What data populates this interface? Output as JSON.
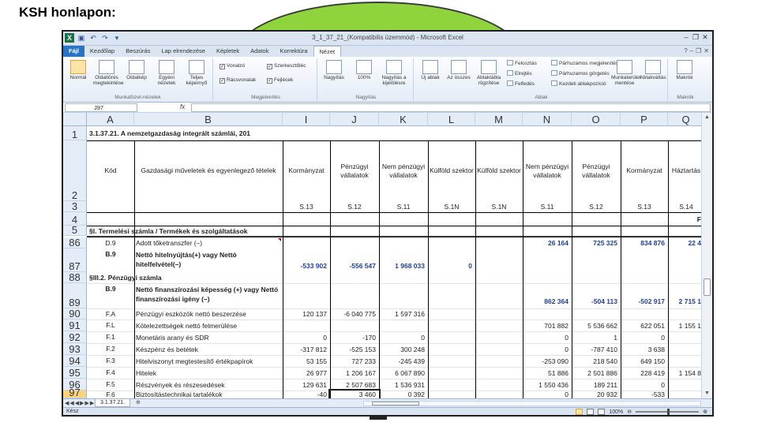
{
  "slide": {
    "title": "KSH honlapon:"
  },
  "window": {
    "title": "3_1_37_21_(Kompatibilis üzemmód) - Microsoft Excel",
    "qat_icons": [
      "excel-logo-icon",
      "save-icon",
      "undo-icon",
      "redo-icon",
      "customize-icon"
    ],
    "controls": [
      "minimize-icon",
      "restore-icon",
      "close-icon"
    ]
  },
  "tabs": [
    {
      "label": "Fájl",
      "kind": "file"
    },
    {
      "label": "Kezdőlap"
    },
    {
      "label": "Beszúrás"
    },
    {
      "label": "Lap elrendezése"
    },
    {
      "label": "Képletek"
    },
    {
      "label": "Adatok"
    },
    {
      "label": "Korrektúra"
    },
    {
      "label": "Nézet",
      "active": true
    }
  ],
  "ribbon": {
    "views": {
      "normal": "Normál",
      "page_break": "Oldaltörés megtekintése",
      "page_layout": "Oldalkép",
      "custom": "Egyéni nézetek",
      "full": "Teljes képernyő",
      "group": "Munkafüzet-nézetek"
    },
    "show": {
      "ruler": "Vonalzó",
      "formula_bar": "Szerkesztőléc",
      "gridlines": "Rácsvonalak",
      "headings": "Fejlécek",
      "group": "Megjelenítés"
    },
    "zoom": {
      "zoom": "Nagyítás",
      "hundred": "100%",
      "selection": "Nagyítás a kijelölésre",
      "group": "Nagyítás"
    },
    "window": {
      "new": "Új ablak",
      "arrange": "Az összes",
      "freeze": "Ablaktábla rögzítése",
      "split": "Felosztás",
      "hide": "Elrejtés",
      "unhide": "Felfedés",
      "side_by_side": "Párhuzamos megjelenítés",
      "sync_scroll": "Párhuzamos görgetés",
      "reset": "Kezdeti ablakpozíció",
      "save_ws": "Munkaterület mentése",
      "switch": "Ablakváltás",
      "group": "Ablak"
    },
    "macros": {
      "label": "Makrók",
      "group": "Makrók"
    }
  },
  "formula_bar": {
    "name_box": "J97",
    "fx": "fx",
    "content": ""
  },
  "columns": [
    "A",
    "B",
    "I",
    "J",
    "K",
    "L",
    "M",
    "N",
    "O",
    "P",
    "Q"
  ],
  "rows": {
    "r1": {
      "num": "1",
      "title": "3.1.37.21. A nemzetgazdaság integrált számlái, 201"
    },
    "r2": {
      "num": "2",
      "A": "Kód",
      "B": "Gazdasági műveletek és egyenlegező tételek",
      "I": "Kormányzat",
      "J": "Pénzügyi vállalatok",
      "K": "Nem pénzügyi vállalatok",
      "L": "Külföld szektor",
      "M": "Külföld szektor",
      "N": "Nem pénzügyi vállalatok",
      "O": "Pénzügyi vállalatok",
      "P": "Kormányzat",
      "Q": "Háztartás"
    },
    "r3": {
      "num": "3",
      "I": "S.13",
      "J": "S.12",
      "K": "S.11",
      "L": "S.1N",
      "M": "S.1N",
      "N": "S.11",
      "O": "S.12",
      "P": "S.13",
      "Q": "S.14"
    },
    "r4": {
      "num": "4",
      "Q": "F"
    },
    "r5": {
      "num": "5",
      "B": "§I. Termelési számla / Termékek és szolgáltatások"
    },
    "r86": {
      "num": "86",
      "A": "D.9",
      "B": "Adott tőketranszfer (–)",
      "N": "26 164",
      "O": "725 325",
      "P": "834 876",
      "Q": "22 4"
    },
    "r87": {
      "num": "87",
      "A": "B.9",
      "B": "Nettó hitelnyújtás(+) vagy Nettó hitelfelvétel(–)",
      "I": "-533 902",
      "J": "-556 547",
      "K": "1 968 033",
      "L": "0"
    },
    "r88": {
      "num": "88",
      "B": "§III.2. Pénzügyi számla"
    },
    "r89": {
      "num": "89",
      "A": "B.9",
      "B": "Nettó finanszírozási képesség (+) vagy Nettó finanszírozási igény (–)",
      "N": "862 364",
      "O": "-504 113",
      "P": "-502 917",
      "Q": "2 715 1"
    },
    "r90": {
      "num": "90",
      "A": "F.A",
      "B": "Pénzügyi eszközök nettó beszerzése",
      "I": "120 137",
      "J": "-6 040 775",
      "K": "1 597 316"
    },
    "r91": {
      "num": "91",
      "A": "F.L",
      "B": "Kötelezettségek nettó felmerülése",
      "N": "701 882",
      "O": "5 536 662",
      "P": "622 051",
      "Q": "1 155 1"
    },
    "r92": {
      "num": "92",
      "A": "F.1",
      "B": "Monetáris arany és SDR",
      "I": "0",
      "J": "-170",
      "K": "0",
      "N": "0",
      "O": "1",
      "P": "0"
    },
    "r93": {
      "num": "93",
      "A": "F.2",
      "B": "Készpénz és betétek",
      "I": "-317 812",
      "J": "-525 153",
      "K": "300 248",
      "N": "0",
      "O": "-787 410",
      "P": "3 638"
    },
    "r94": {
      "num": "94",
      "A": "F.3",
      "B": "Hitelviszonyt megtestesítő értékpapírok",
      "I": "53 155",
      "J": "727 233",
      "K": "-245 439",
      "N": "-253 090",
      "O": "218 540",
      "P": "649 150"
    },
    "r95": {
      "num": "95",
      "A": "F.4",
      "B": "Hitelek",
      "I": "26 977",
      "J": "1 206 167",
      "K": "6 067 890",
      "N": "51 886",
      "O": "2 501 886",
      "P": "228 419",
      "Q": "1 154 8"
    },
    "r96": {
      "num": "96",
      "A": "F.5",
      "B": "Részvények és részesedések",
      "I": "129 631",
      "J": "2 507 683",
      "K": "1 536 931",
      "N": "1 550 436",
      "O": "189 211",
      "P": "0"
    },
    "r97": {
      "num": "97",
      "A": "F.6",
      "B": "Biztosítástechnikai tartalékok",
      "I": "-40",
      "J": "3 460",
      "K": "0 392",
      "N": "0",
      "O": "20 932",
      "P": "-533"
    }
  },
  "sheet_tabs": [
    {
      "label": "3.1.37.21."
    }
  ],
  "status": {
    "left": "Kész",
    "zoom": "100%"
  },
  "colors": {
    "green_shape": "#8fd43c",
    "accent_blue": "#2a73c4",
    "value_blue": "#1f3f9f",
    "selected_row": "#fbd37b"
  }
}
